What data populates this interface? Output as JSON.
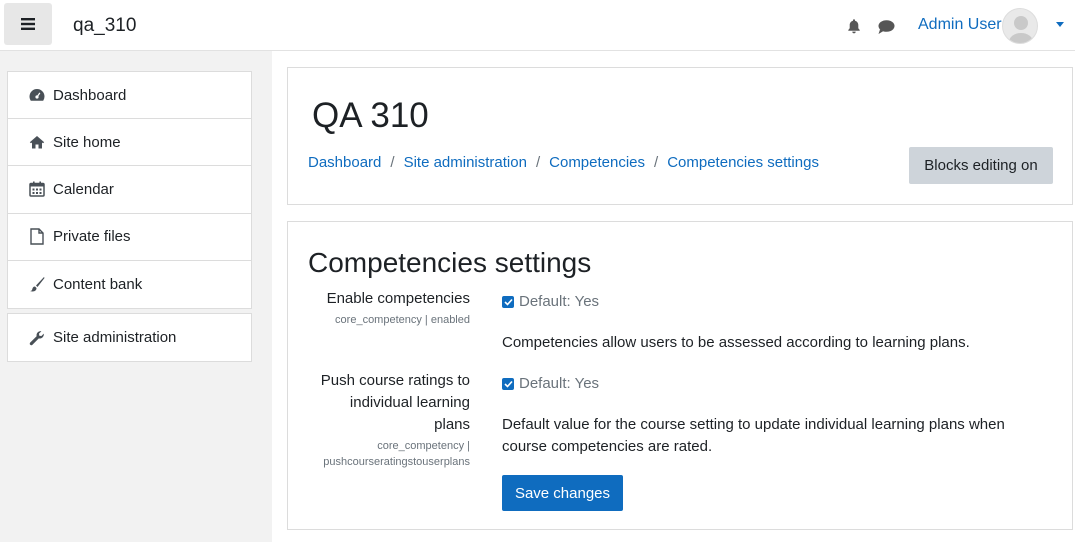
{
  "navbar": {
    "site_name": "qa_310",
    "user_name": "Admin User",
    "icons": [
      "hamburger-icon",
      "bell-icon",
      "chat-icon",
      "avatar",
      "caret-down-icon"
    ]
  },
  "drawer": {
    "items": [
      {
        "label": "Dashboard",
        "icon": "dashboard-icon"
      },
      {
        "label": "Site home",
        "icon": "home-icon"
      },
      {
        "label": "Calendar",
        "icon": "calendar-icon"
      },
      {
        "label": "Private files",
        "icon": "file-icon"
      },
      {
        "label": "Content bank",
        "icon": "paintbrush-icon"
      }
    ],
    "admin_item": {
      "label": "Site administration",
      "icon": "wrench-icon"
    }
  },
  "header": {
    "title": "QA 310",
    "breadcrumb": [
      "Dashboard",
      "Site administration",
      "Competencies",
      "Competencies settings"
    ],
    "separator": "/",
    "blocks_button": "Blocks editing on"
  },
  "settings": {
    "title": "Competencies settings",
    "items": [
      {
        "label": "Enable competencies",
        "key": "core_competency | enabled",
        "checked": true,
        "default_text": "Default: Yes",
        "description": "Competencies allow users to be assessed according to learning plans."
      },
      {
        "label_lines": [
          "Push course ratings to",
          "individual learning",
          "plans"
        ],
        "key_lines": [
          "core_competency |",
          "pushcourseratingstouserplans"
        ],
        "checked": true,
        "default_text": "Default: Yes",
        "description_lines": [
          "Default value for the course setting to update individual learning plans when",
          "course competencies are rated."
        ]
      }
    ],
    "save_button": "Save changes"
  },
  "colors": {
    "link": "#0f6cbf",
    "primary": "#0f6cbf",
    "secondary_button": "#ced4da",
    "drawer_bg": "#f2f2f2"
  }
}
